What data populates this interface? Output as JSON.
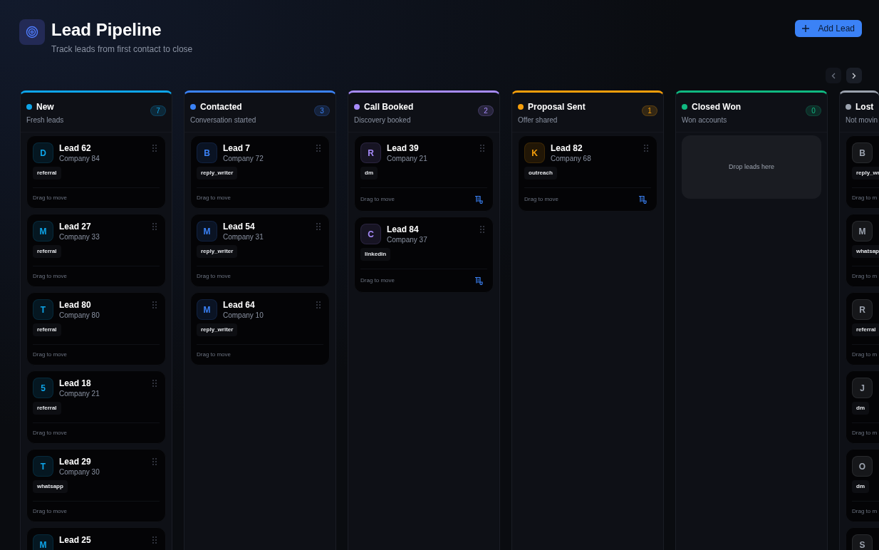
{
  "header": {
    "title": "Lead Pipeline",
    "subtitle": "Track leads from first contact to close"
  },
  "add_button": {
    "label": "Add Lead"
  },
  "columns": [
    {
      "title": "New",
      "subtitle": "Fresh leads",
      "count": "7",
      "color": "#0ea5e9",
      "cards": [
        {
          "initial": "D",
          "name": "Lead 62",
          "company": "Company 84",
          "tag": "referral",
          "footer": "Drag to move",
          "has_document": false
        },
        {
          "initial": "M",
          "name": "Lead 27",
          "company": "Company 33",
          "tag": "referral",
          "footer": "Drag to move",
          "has_document": false
        },
        {
          "initial": "T",
          "name": "Lead 80",
          "company": "Company 80",
          "tag": "referral",
          "footer": "Drag to move",
          "has_document": false
        },
        {
          "initial": "5",
          "name": "Lead 18",
          "company": "Company 21",
          "tag": "referral",
          "footer": "Drag to move",
          "has_document": false
        },
        {
          "initial": "T",
          "name": "Lead 29",
          "company": "Company 30",
          "tag": "whatsapp",
          "footer": "Drag to move",
          "has_document": false
        },
        {
          "initial": "M",
          "name": "Lead 25",
          "has_document": false
        }
      ]
    },
    {
      "title": "Contacted",
      "subtitle": "Conversation started",
      "count": "3",
      "color": "#3b82f6",
      "cards": [
        {
          "initial": "B",
          "name": "Lead 7",
          "company": "Company 72",
          "tag": "reply_writer",
          "footer": "Drag to move",
          "has_document": false
        },
        {
          "initial": "M",
          "name": "Lead 54",
          "company": "Company 31",
          "tag": "reply_writer",
          "footer": "Drag to move",
          "has_document": false
        },
        {
          "initial": "M",
          "name": "Lead 64",
          "company": "Company 10",
          "tag": "reply_writer",
          "footer": "Drag to move",
          "has_document": false
        }
      ]
    },
    {
      "title": "Call Booked",
      "subtitle": "Discovery booked",
      "count": "2",
      "color": "#a78bfa",
      "cards": [
        {
          "initial": "R",
          "name": "Lead 39",
          "company": "Company 21",
          "tag": "dm",
          "footer": "Drag to move",
          "has_document": true
        },
        {
          "initial": "C",
          "name": "Lead 84",
          "company": "Company 37",
          "tag": "linkedin",
          "footer": "Drag to move",
          "has_document": true
        }
      ]
    },
    {
      "title": "Proposal Sent",
      "subtitle": "Offer shared",
      "count": "1",
      "color": "#f59e0b",
      "cards": [
        {
          "initial": "K",
          "name": "Lead 82",
          "company": "Company 68",
          "tag": "outreach",
          "footer": "Drag to move",
          "has_document": true
        }
      ]
    },
    {
      "title": "Closed Won",
      "subtitle": "Won accounts",
      "count": "0",
      "color": "#10b981",
      "empty_text": "Drop leads here"
    },
    {
      "title": "Lost",
      "subtitle": "Not movin",
      "color": "#9ca3af",
      "cards": [
        {
          "initial": "B",
          "tag": "reply_wr",
          "footer": "Drag to m",
          "has_document": false
        },
        {
          "initial": "M",
          "tag": "whatsap",
          "footer": "Drag to m",
          "has_document": false
        },
        {
          "initial": "R",
          "tag": "referral",
          "footer": "Drag to m",
          "has_document": false
        },
        {
          "initial": "J",
          "tag": "dm",
          "footer": "Drag to m",
          "has_document": false
        },
        {
          "initial": "O",
          "tag": "dm",
          "footer": "Drag to m",
          "has_document": false
        },
        {
          "initial": "S",
          "has_document": false
        }
      ]
    }
  ]
}
